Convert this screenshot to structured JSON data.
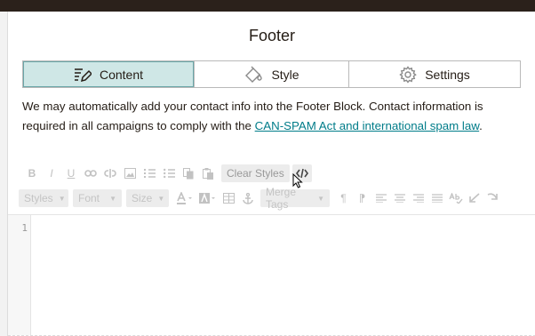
{
  "panel": {
    "title": "Footer"
  },
  "tabs": [
    {
      "label": "Content",
      "icon": "edit-list-icon",
      "active": true
    },
    {
      "label": "Style",
      "icon": "paint-bucket-icon",
      "active": false
    },
    {
      "label": "Settings",
      "icon": "gear-icon",
      "active": false
    }
  ],
  "description": {
    "text": "We may automatically add your contact info into the Footer Block. Contact information is required in all campaigns to comply with the ",
    "link": "CAN-SPAM Act and international spam law",
    "end": "."
  },
  "toolbar1": {
    "bold": "B",
    "italic": "I",
    "underline": "U",
    "clear_styles": "Clear Styles"
  },
  "toolbar2": {
    "styles": "Styles",
    "font": "Font",
    "size": "Size",
    "merge_tags": "Merge Tags"
  },
  "editor": {
    "line_number": "1"
  },
  "colors": {
    "accent": "#007c89",
    "active_tab_bg": "#cfe7e6",
    "topbar": "#2b211b"
  }
}
